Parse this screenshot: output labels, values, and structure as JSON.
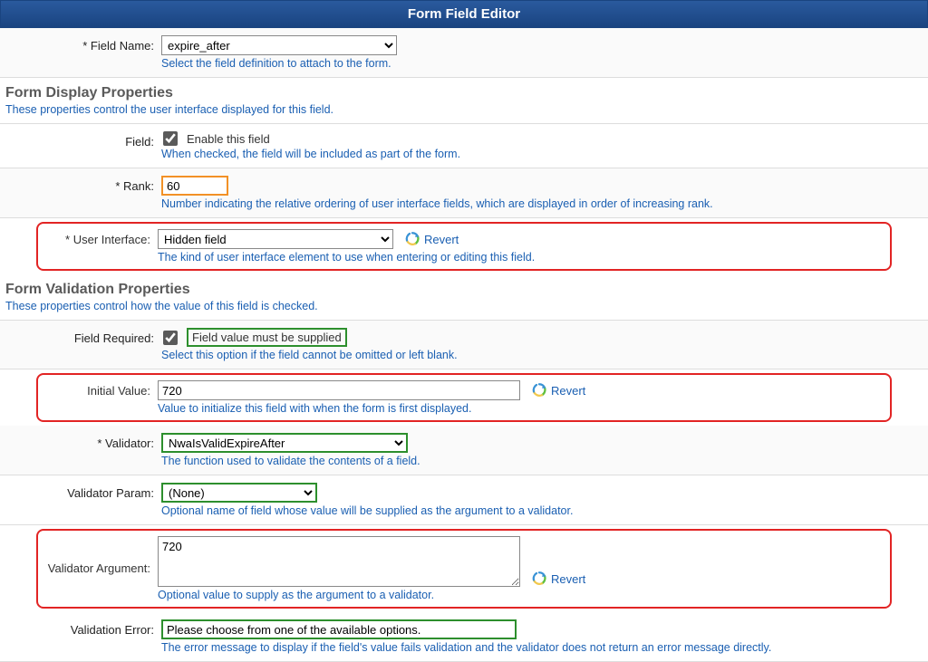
{
  "header": {
    "title": "Form Field Editor"
  },
  "fieldName": {
    "label": "Field Name:",
    "value": "expire_after",
    "help": "Select the field definition to attach to the form."
  },
  "displaySection": {
    "title": "Form Display Properties",
    "desc": "These properties control the user interface displayed for this field."
  },
  "enableField": {
    "label": "Field:",
    "checkbox_label": "Enable this field",
    "checked": true,
    "help": "When checked, the field will be included as part of the form."
  },
  "rank": {
    "label": "Rank:",
    "value": "60",
    "help": "Number indicating the relative ordering of user interface fields, which are displayed in order of increasing rank."
  },
  "ui": {
    "label": "User Interface:",
    "value": "Hidden field",
    "revert": "Revert",
    "help": "The kind of user interface element to use when entering or editing this field."
  },
  "validationSection": {
    "title": "Form Validation Properties",
    "desc": "These properties control how the value of this field is checked."
  },
  "fieldRequired": {
    "label": "Field Required:",
    "checkbox_label": "Field value must be supplied",
    "checked": true,
    "help": "Select this option if the field cannot be omitted or left blank."
  },
  "initialValue": {
    "label": "Initial Value:",
    "value": "720",
    "revert": "Revert",
    "help": "Value to initialize this field with when the form is first displayed."
  },
  "validator": {
    "label": "Validator:",
    "value": "NwaIsValidExpireAfter",
    "help": "The function used to validate the contents of a field."
  },
  "validatorParam": {
    "label": "Validator Param:",
    "value": "(None)",
    "help": "Optional name of field whose value will be supplied as the argument to a validator."
  },
  "validatorArg": {
    "label": "Validator Argument:",
    "value": "720",
    "revert": "Revert",
    "help": "Optional value to supply as the argument to a validator."
  },
  "validationError": {
    "label": "Validation Error:",
    "value": "Please choose from one of the available options.",
    "help": "The error message to display if the field's value fails validation and the validator does not return an error message directly."
  }
}
